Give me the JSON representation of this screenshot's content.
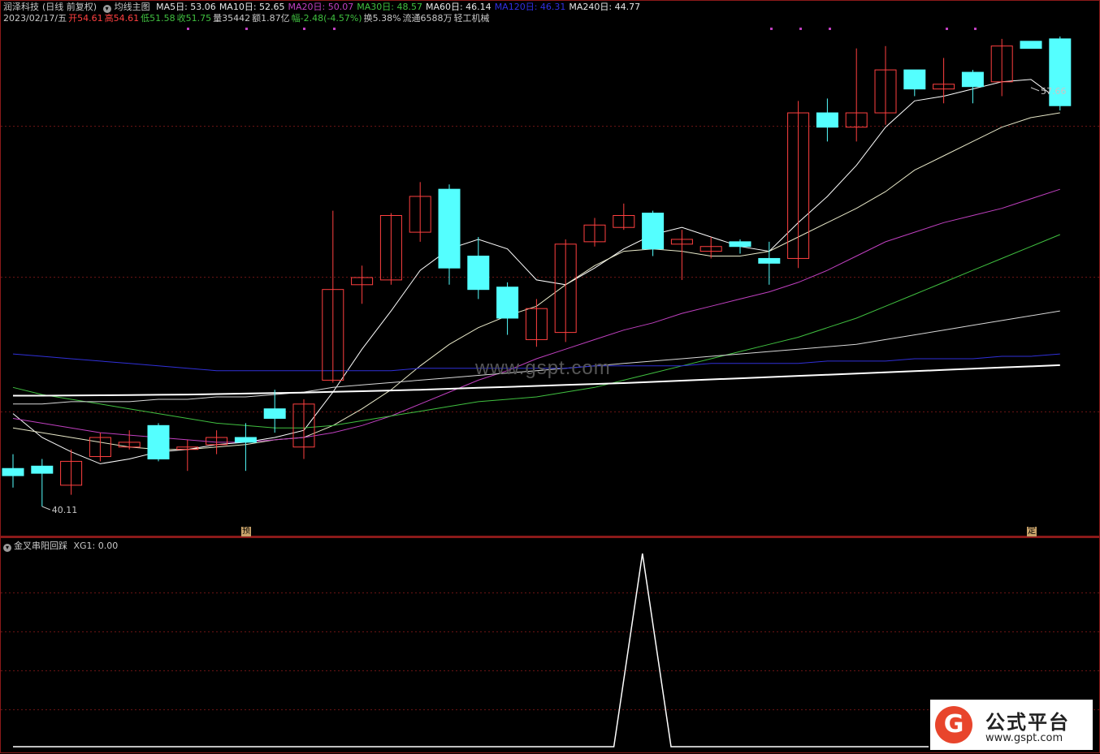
{
  "header": {
    "stock_name": "润泽科技",
    "period": "(日线 前复权)",
    "formula_label": "均线主图",
    "ma": [
      {
        "label": "MA5日: 53.06",
        "color": "#e6e6e6"
      },
      {
        "label": "MA10日: 52.65",
        "color": "#e6e6e6"
      },
      {
        "label": "MA20日: 50.07",
        "color": "#c040c0"
      },
      {
        "label": "MA30日: 48.57",
        "color": "#40c040"
      },
      {
        "label": "MA60日: 46.14",
        "color": "#e6e6e6"
      },
      {
        "label": "MA120日: 46.31",
        "color": "#3030e0"
      },
      {
        "label": "MA240日: 44.77",
        "color": "#e6e6e6"
      }
    ],
    "quote": [
      {
        "text": "2023/02/17/五",
        "color": "#c8c8c8"
      },
      {
        "text": "开54.61",
        "color": "#ff4040"
      },
      {
        "text": "高54.61",
        "color": "#ff4040"
      },
      {
        "text": "低51.58",
        "color": "#40c040"
      },
      {
        "text": "收51.75",
        "color": "#40c040"
      },
      {
        "text": "量35442",
        "color": "#c8c8c8"
      },
      {
        "text": "额1.87亿",
        "color": "#c8c8c8"
      },
      {
        "text": "幅-2.48(-4.57%)",
        "color": "#40c040"
      },
      {
        "text": "换5.38%",
        "color": "#c8c8c8"
      },
      {
        "text": "流通6588万",
        "color": "#c8c8c8"
      },
      {
        "text": "轻工机械",
        "color": "#c8c8c8"
      }
    ]
  },
  "sub_header": {
    "name": "金叉串阳回踩",
    "value": "XG1: 0.00"
  },
  "markers": {
    "pre": "预",
    "fixed": "定"
  },
  "watermark": "www.gspt.com",
  "logo": {
    "mark": "G",
    "title": "公式平台",
    "url": "www.gspt.com"
  },
  "chart_data": [
    {
      "type": "candlestick",
      "title": "均线主图",
      "ylim": [
        40.11,
        57.66
      ],
      "annotations": [
        {
          "text": "57.66",
          "value": 57.66,
          "index": 35
        },
        {
          "text": "40.11",
          "value": 40.11,
          "index": 1
        }
      ],
      "up_color": "#ff4040",
      "down_color": "#54ffff",
      "candles": [
        {
          "o": 41.7,
          "h": 42.3,
          "l": 40.9,
          "c": 41.4
        },
        {
          "o": 41.8,
          "h": 42.1,
          "l": 40.11,
          "c": 41.5
        },
        {
          "o": 41.0,
          "h": 42.5,
          "l": 40.6,
          "c": 42.0
        },
        {
          "o": 42.2,
          "h": 43.2,
          "l": 42.0,
          "c": 43.0
        },
        {
          "o": 42.6,
          "h": 43.3,
          "l": 42.5,
          "c": 42.8
        },
        {
          "o": 43.5,
          "h": 43.6,
          "l": 42.0,
          "c": 42.1
        },
        {
          "o": 42.5,
          "h": 42.9,
          "l": 41.6,
          "c": 42.6
        },
        {
          "o": 42.7,
          "h": 43.3,
          "l": 42.3,
          "c": 43.0
        },
        {
          "o": 43.0,
          "h": 43.6,
          "l": 41.6,
          "c": 42.8
        },
        {
          "o": 44.2,
          "h": 45.0,
          "l": 43.2,
          "c": 43.8
        },
        {
          "o": 42.6,
          "h": 44.6,
          "l": 42.1,
          "c": 44.4
        },
        {
          "o": 45.4,
          "h": 52.5,
          "l": 45.3,
          "c": 49.2
        },
        {
          "o": 49.4,
          "h": 50.2,
          "l": 48.6,
          "c": 49.7
        },
        {
          "o": 49.6,
          "h": 52.4,
          "l": 49.4,
          "c": 52.3
        },
        {
          "o": 51.6,
          "h": 53.7,
          "l": 51.2,
          "c": 53.1
        },
        {
          "o": 53.4,
          "h": 53.6,
          "l": 49.4,
          "c": 50.1
        },
        {
          "o": 50.6,
          "h": 51.4,
          "l": 48.8,
          "c": 49.2
        },
        {
          "o": 49.3,
          "h": 49.5,
          "l": 47.3,
          "c": 48.0
        },
        {
          "o": 47.1,
          "h": 48.8,
          "l": 46.8,
          "c": 48.4
        },
        {
          "o": 47.4,
          "h": 51.3,
          "l": 47.0,
          "c": 51.1
        },
        {
          "o": 51.2,
          "h": 52.2,
          "l": 51.0,
          "c": 51.9
        },
        {
          "o": 51.8,
          "h": 52.8,
          "l": 51.7,
          "c": 52.3
        },
        {
          "o": 52.4,
          "h": 52.5,
          "l": 50.6,
          "c": 50.9
        },
        {
          "o": 51.1,
          "h": 51.7,
          "l": 49.6,
          "c": 51.3
        },
        {
          "o": 50.8,
          "h": 51.4,
          "l": 50.5,
          "c": 51.0
        },
        {
          "o": 51.2,
          "h": 51.3,
          "l": 50.7,
          "c": 51.0
        },
        {
          "o": 50.5,
          "h": 51.2,
          "l": 49.4,
          "c": 50.3
        },
        {
          "o": 50.5,
          "h": 57.1,
          "l": 50.1,
          "c": 56.6
        },
        {
          "o": 56.6,
          "h": 57.2,
          "l": 55.4,
          "c": 56.0
        },
        {
          "o": 56.0,
          "h": 59.3,
          "l": 55.4,
          "c": 56.6
        },
        {
          "o": 56.6,
          "h": 59.4,
          "l": 56.1,
          "c": 58.4
        },
        {
          "o": 58.4,
          "h": 58.4,
          "l": 57.3,
          "c": 57.6
        },
        {
          "o": 57.6,
          "h": 58.9,
          "l": 57.0,
          "c": 57.8
        },
        {
          "o": 58.3,
          "h": 58.4,
          "l": 57.0,
          "c": 57.7
        },
        {
          "o": 57.9,
          "h": 59.7,
          "l": 57.3,
          "c": 59.4
        },
        {
          "o": 59.6,
          "h": 57.66,
          "l": 59.5,
          "c": 59.3
        },
        {
          "o": 59.7,
          "h": 59.8,
          "l": 56.7,
          "c": 56.9
        }
      ],
      "series": [
        {
          "name": "MA5",
          "color": "#ffffff",
          "values": [
            44.0,
            43.0,
            42.4,
            41.9,
            42.1,
            42.4,
            42.5,
            42.7,
            42.8,
            43.0,
            43.3,
            44.9,
            46.7,
            48.3,
            50.0,
            50.9,
            51.3,
            50.9,
            49.6,
            49.4,
            50.1,
            50.9,
            51.5,
            51.8,
            51.4,
            51.0,
            50.8,
            52.0,
            53.1,
            54.4,
            56.0,
            57.1,
            57.3,
            57.6,
            57.9,
            58.0,
            57.1
          ]
        },
        {
          "name": "MA10",
          "color": "#e8e8c8",
          "values": [
            43.4,
            43.2,
            43.0,
            42.8,
            42.6,
            42.5,
            42.5,
            42.6,
            42.7,
            42.9,
            43.0,
            43.5,
            44.2,
            45.0,
            46.0,
            46.9,
            47.6,
            48.1,
            48.5,
            49.4,
            50.2,
            50.8,
            50.9,
            50.8,
            50.6,
            50.6,
            50.8,
            51.4,
            52.0,
            52.6,
            53.3,
            54.2,
            54.8,
            55.4,
            56.0,
            56.4,
            56.6
          ]
        },
        {
          "name": "MA20",
          "color": "#c040c0",
          "values": [
            43.8,
            43.6,
            43.4,
            43.2,
            43.1,
            43.0,
            42.9,
            42.8,
            42.8,
            42.9,
            43.0,
            43.2,
            43.5,
            43.9,
            44.4,
            44.9,
            45.4,
            45.8,
            46.3,
            46.7,
            47.1,
            47.5,
            47.8,
            48.2,
            48.5,
            48.8,
            49.1,
            49.5,
            50.0,
            50.6,
            51.2,
            51.6,
            52.0,
            52.3,
            52.6,
            53.0,
            53.4
          ]
        },
        {
          "name": "MA30",
          "color": "#40c040",
          "values": [
            45.1,
            44.8,
            44.6,
            44.4,
            44.2,
            44.0,
            43.8,
            43.6,
            43.5,
            43.4,
            43.4,
            43.5,
            43.7,
            43.9,
            44.1,
            44.3,
            44.5,
            44.6,
            44.7,
            44.9,
            45.1,
            45.4,
            45.7,
            46.0,
            46.3,
            46.6,
            46.9,
            47.2,
            47.6,
            48.0,
            48.5,
            49.0,
            49.5,
            50.0,
            50.5,
            51.0,
            51.5
          ]
        },
        {
          "name": "MA60",
          "color": "#d8d8d8",
          "values": [
            44.4,
            44.4,
            44.5,
            44.5,
            44.5,
            44.6,
            44.6,
            44.7,
            44.7,
            44.8,
            44.9,
            45.1,
            45.2,
            45.3,
            45.4,
            45.5,
            45.6,
            45.7,
            45.8,
            45.9,
            46.0,
            46.1,
            46.2,
            46.3,
            46.4,
            46.5,
            46.6,
            46.7,
            46.8,
            46.9,
            47.1,
            47.3,
            47.5,
            47.7,
            47.9,
            48.1,
            48.3
          ]
        },
        {
          "name": "MA120",
          "color": "#3030d8",
          "values": [
            46.5,
            46.4,
            46.3,
            46.2,
            46.1,
            46.0,
            45.9,
            45.8,
            45.8,
            45.8,
            45.8,
            45.8,
            45.8,
            45.8,
            45.9,
            45.9,
            45.9,
            45.9,
            45.9,
            45.9,
            46.0,
            46.0,
            46.0,
            46.0,
            46.1,
            46.1,
            46.1,
            46.1,
            46.2,
            46.2,
            46.2,
            46.3,
            46.3,
            46.3,
            46.4,
            46.4,
            46.5
          ]
        },
        {
          "name": "MA240",
          "color": "#ffffff",
          "values": [
            44.75,
            44.75,
            44.76,
            44.77,
            44.78,
            44.79,
            44.8,
            44.82,
            44.84,
            44.86,
            44.88,
            44.91,
            44.94,
            44.97,
            45.0,
            45.04,
            45.08,
            45.12,
            45.16,
            45.2,
            45.24,
            45.28,
            45.33,
            45.38,
            45.43,
            45.48,
            45.53,
            45.58,
            45.63,
            45.68,
            45.73,
            45.78,
            45.83,
            45.88,
            45.93,
            45.98,
            46.03
          ]
        }
      ]
    },
    {
      "type": "line",
      "title": "金叉串阳回踩",
      "series": [
        {
          "name": "XG1",
          "values": [
            0,
            0,
            0,
            0,
            0,
            0,
            0,
            0,
            0,
            0,
            0,
            0,
            0,
            0,
            0,
            0,
            0,
            0,
            0,
            0,
            0,
            0,
            1,
            0,
            0,
            0,
            0,
            0,
            0,
            0,
            0,
            0,
            0
          ]
        }
      ]
    }
  ]
}
